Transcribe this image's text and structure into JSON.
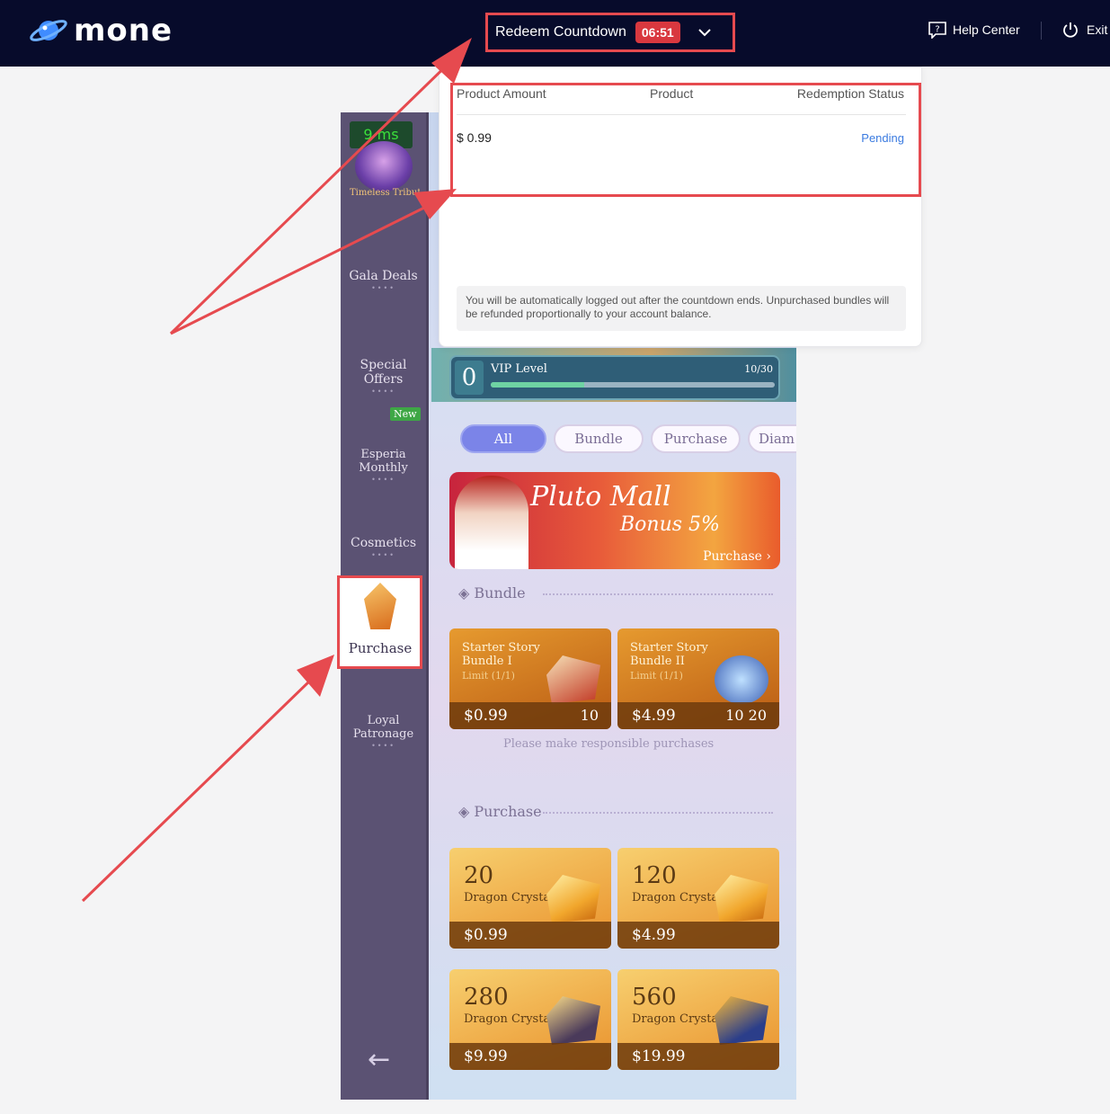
{
  "header": {
    "brand": "mone",
    "countdown_label": "Redeem Countdown",
    "countdown_time": "06:51",
    "help_label": "Help Center",
    "exit_label": "Exit"
  },
  "popup": {
    "columns": [
      "Product Amount",
      "Product",
      "Redemption Status"
    ],
    "rows": [
      {
        "amount": "$ 0.99",
        "product": "",
        "status": "Pending"
      }
    ],
    "notice": "You will be automatically logged out after the countdown ends. Unpurchased bundles will be refunded proportionally to your account balance."
  },
  "game": {
    "sidebar": {
      "ms_badge": "9 ms",
      "avatar_caption": "Timeless Tribute",
      "items": [
        {
          "label": "Gala Deals"
        },
        {
          "label": "Special Offers"
        },
        {
          "label": "Esperia Monthly",
          "badge": "New"
        },
        {
          "label": "Cosmetics"
        },
        {
          "label": "Purchase"
        },
        {
          "label": "Loyal Patronage"
        }
      ],
      "back_glyph": "←"
    },
    "vip": {
      "level": "0",
      "label": "VIP Level",
      "progress_text": "10/30",
      "progress": 0.33
    },
    "tabs": [
      "All",
      "Bundle",
      "Purchase",
      "Diam"
    ],
    "active_tab": "All",
    "banner": {
      "title": "Pluto Mall",
      "bonus": "Bonus 5%",
      "cta": "Purchase"
    },
    "sections": {
      "bundle_title": "Bundle",
      "purchase_title": "Purchase"
    },
    "bundles": [
      {
        "name": "Starter Story Bundle I",
        "limit": "Limit (1/1)",
        "price": "$0.99",
        "extra": "10"
      },
      {
        "name": "Starter Story Bundle II",
        "limit": "Limit (1/1)",
        "price": "$4.99",
        "extra": "10  20"
      }
    ],
    "responsible_note": "Please make responsible purchases",
    "crystals": [
      {
        "qty": "20",
        "unit": "Dragon Crystals",
        "price": "$0.99"
      },
      {
        "qty": "120",
        "unit": "Dragon Crystals",
        "price": "$4.99"
      },
      {
        "qty": "280",
        "unit": "Dragon Crystals",
        "price": "$9.99"
      },
      {
        "qty": "560",
        "unit": "Dragon Crystals",
        "price": "$19.99"
      }
    ]
  },
  "colors": {
    "topbar": "#070b2b",
    "highlight": "#e64a4f",
    "countdown_badge": "#d9383f",
    "pending": "#3b7be0"
  }
}
